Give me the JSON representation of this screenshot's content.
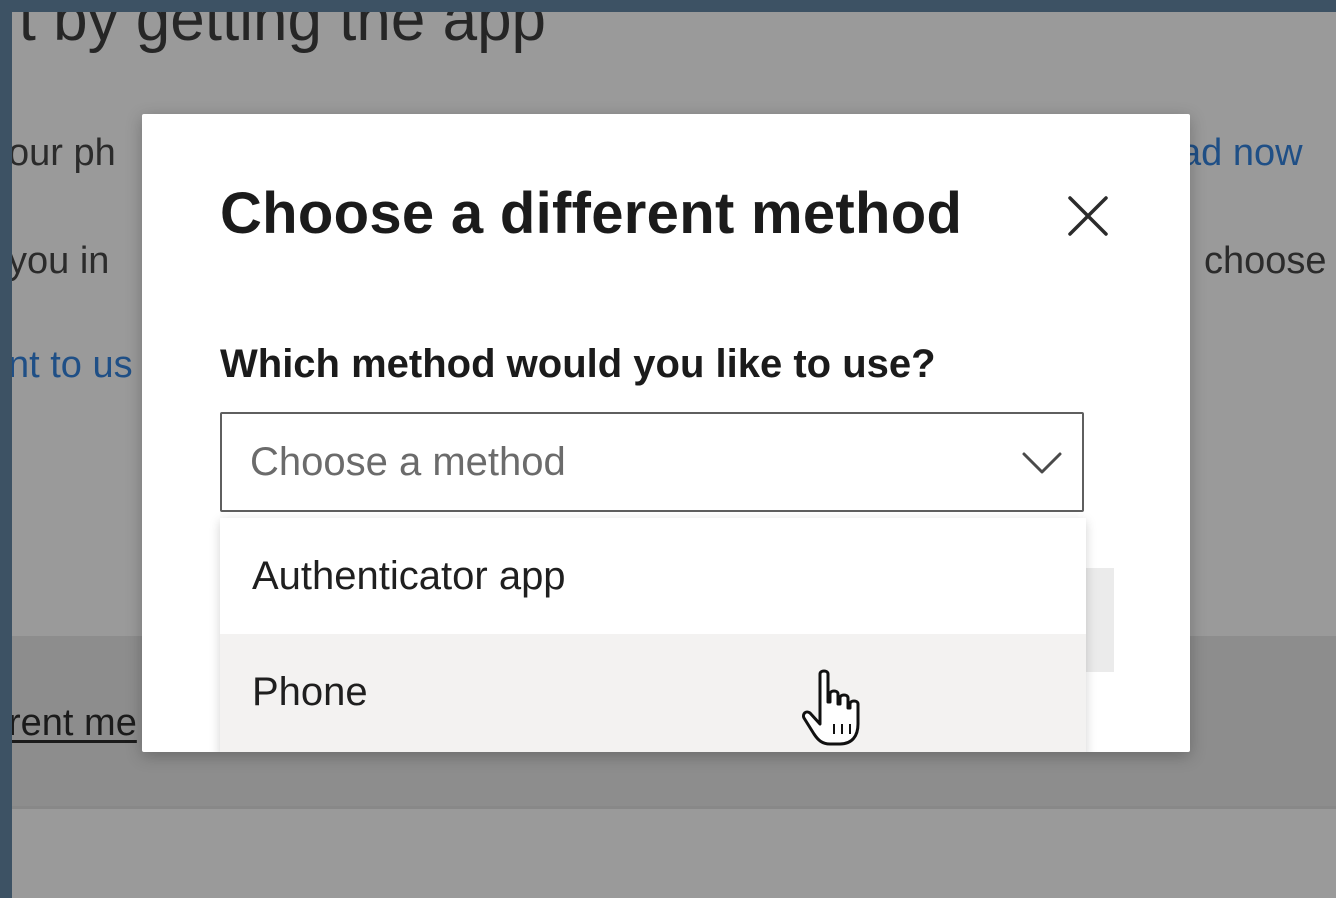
{
  "background_page": {
    "heading": "rt by getting the app",
    "line1": "our ph",
    "line2": "you in",
    "line3": "nt to us",
    "right1": "ad now",
    "right2": "choose",
    "footer_link": "rent me"
  },
  "modal": {
    "title": "Choose a different method",
    "close_icon": "close-icon",
    "field_label": "Which method would you like to use?",
    "select": {
      "placeholder": "Choose a method",
      "icon": "chevron-down-icon",
      "expanded": true,
      "options": [
        {
          "label": "Authenticator app",
          "hovered": false
        },
        {
          "label": "Phone",
          "hovered": true
        }
      ]
    }
  },
  "pointer": "hand-pointer-icon",
  "colors": {
    "overlay_bg": "#9a9a9a",
    "outer_border": "#3d5264",
    "link_blue": "#1f4f86",
    "hover_bg": "#f3f2f1"
  }
}
